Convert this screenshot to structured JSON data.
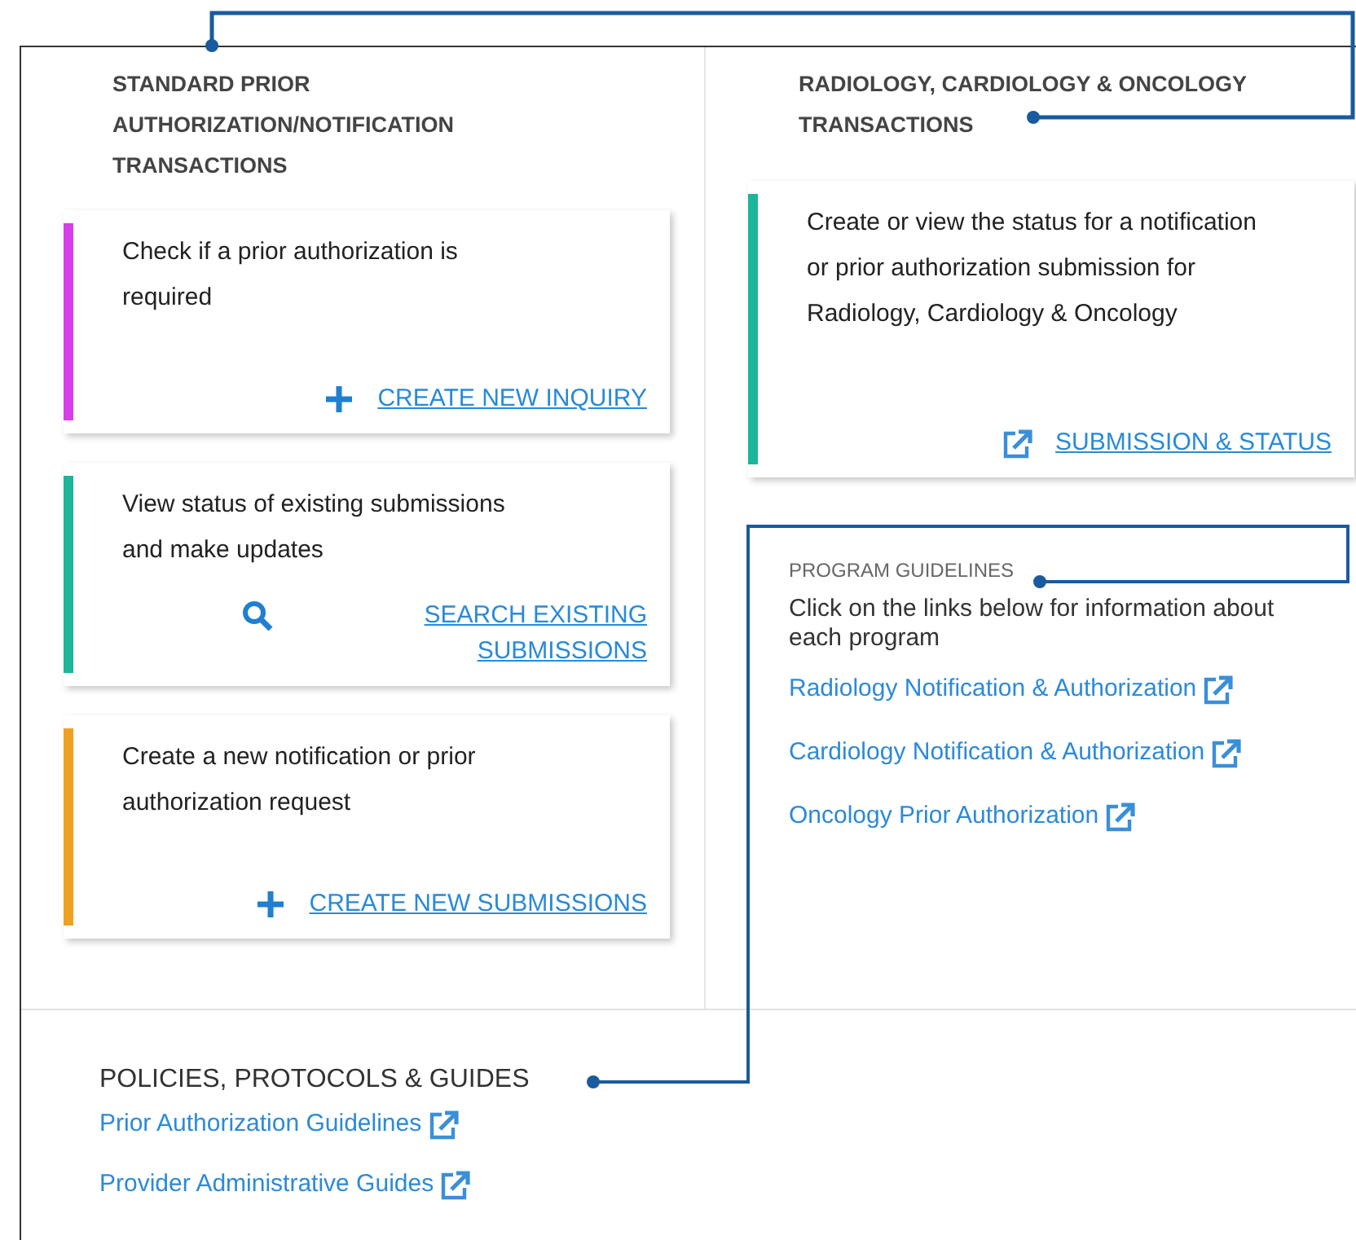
{
  "left_column": {
    "heading": "STANDARD PRIOR AUTHORIZATION/NOTIFICATION TRANSACTIONS",
    "cards": [
      {
        "text": "Check if a prior authorization is required",
        "color": "#d63ee8",
        "link": {
          "kind": "plus",
          "label": "CREATE NEW INQUIRY"
        }
      },
      {
        "text": "View status of existing submissions and make updates",
        "color": "#1bb59a",
        "link": {
          "kind": "search",
          "label": "SEARCH EXISTING SUBMISSIONS"
        }
      },
      {
        "text": "Create a new notification or prior authorization request",
        "color": "#f0a020",
        "link": {
          "kind": "plus",
          "label": "CREATE NEW SUBMISSIONS"
        }
      }
    ]
  },
  "right_column": {
    "heading": "RADIOLOGY, CARDIOLOGY & ONCOLOGY TRANSACTIONS",
    "cards": [
      {
        "text": "Create or view the status for a notification or prior authorization submission for Radiology, Cardiology & Oncology",
        "color": "#1bb59a",
        "link": {
          "kind": "external",
          "label": "SUBMISSION & STATUS"
        }
      }
    ],
    "program_guidelines": {
      "title": "PROGRAM GUIDELINES",
      "description": "Click on the links below for information about each program",
      "links": [
        "Radiology Notification & Authorization",
        "Cardiology Notification & Authorization",
        "Oncology Prior Authorization"
      ]
    }
  },
  "policies": {
    "heading": "POLICIES, PROTOCOLS & GUIDES",
    "links": [
      "Prior Authorization Guidelines",
      "Provider Administrative Guides"
    ]
  }
}
